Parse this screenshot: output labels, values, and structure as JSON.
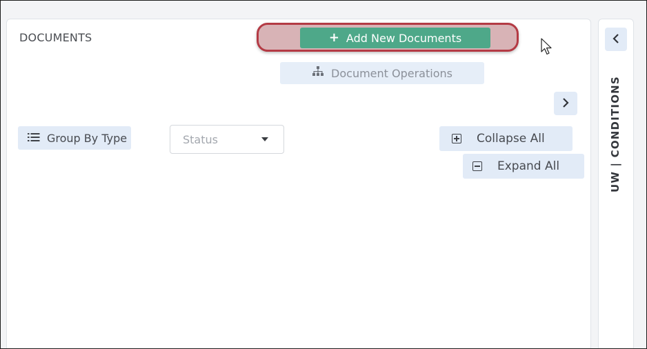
{
  "documents_panel": {
    "title": "DOCUMENTS",
    "add_button_label": "Add New Documents",
    "add_button_icon": "plus-icon",
    "doc_operations_label": "Document Operations",
    "doc_operations_icon": "sitemap-icon",
    "next_icon": "chevron-right-icon",
    "group_by_label": "Group By Type",
    "group_by_icon": "list-icon",
    "status_select": {
      "placeholder": "Status",
      "icon": "caret-down-icon"
    },
    "collapse_all_label": "Collapse All",
    "collapse_all_icon": "plus-square-icon",
    "expand_all_label": "Expand All",
    "expand_all_icon": "minus-square-icon"
  },
  "side_rail": {
    "back_icon": "chevron-left-icon",
    "label": "UW | CONDITIONS"
  },
  "colors": {
    "accent_green": "#4ea889",
    "highlight_red": "#b43a44",
    "button_bg": "#e2ebf7"
  }
}
